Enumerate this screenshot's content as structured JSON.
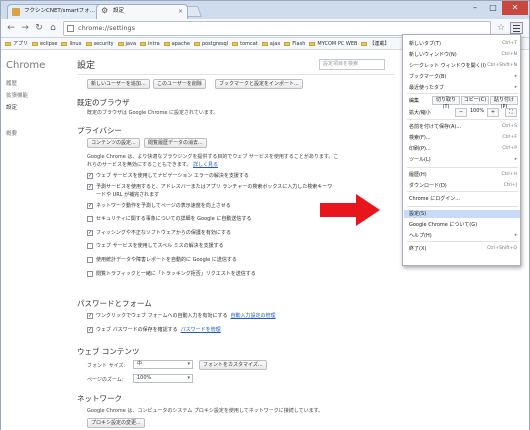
{
  "window": {
    "tabs": [
      {
        "title": "フクシンCNET/smartフォ…"
      },
      {
        "title": "設定"
      }
    ],
    "controls": {
      "minimize": "–",
      "maximize": "□",
      "close": "✕"
    }
  },
  "toolbar": {
    "url": "chrome://settings"
  },
  "bookmarks": [
    "アプリ",
    "eclipse",
    "linux",
    "security",
    "java",
    "intra",
    "apache",
    "postgresql",
    "tomcat",
    "ajax",
    "Flash",
    "MYCOM PC WEB",
    "【連載】"
  ],
  "sidebar": {
    "brand": "Chrome",
    "items": [
      "履歴",
      "拡張機能",
      "設定",
      "概要"
    ]
  },
  "settings": {
    "title": "設定",
    "search_placeholder": "設定項目を検索",
    "user_buttons": [
      "新しいユーザーを追加...",
      "このユーザーを削除",
      "ブックマークと設定をインポート..."
    ],
    "default_browser": {
      "heading": "既定のブラウザ",
      "text": "既定のブラウザは Google Chrome に設定されています。"
    },
    "privacy": {
      "heading": "プライバシー",
      "buttons": [
        "コンテンツの設定...",
        "閲覧履歴データの消去..."
      ],
      "desc1": "Google Chrome は、より快適なブラウジングを提供する目的でウェブ サービスを使用することがあります。こ",
      "desc2": "れらのサービスを無効にすることもできます。",
      "learn_more": "詳しく見る",
      "options": [
        {
          "label": "ウェブ サービスを使用してナビゲーション エラーの解決を支援する",
          "checked": true
        },
        {
          "label": "予測サービスを使用すると、アドレスバーまたはアプリ ランチャーの検索ボックスに入力した検索キーワ",
          "label2": "ードや URL が補完されます",
          "checked": true
        },
        {
          "label": "ネットワーク動作を予測してページの表示速度を向上させる",
          "checked": true
        },
        {
          "label": "セキュリティに関する事象についての詳細を Google に自動送信する",
          "checked": false
        },
        {
          "label": "フィッシングや不正なソフトウェアからの保護を有効にする",
          "checked": true
        },
        {
          "label": "ウェブ サービスを使用してスペル ミスの解決を支援する",
          "checked": false
        },
        {
          "label": "使用統計データや障害レポートを自動的に Google に送信する",
          "checked": false
        },
        {
          "label": "閲覧トラフィックと一緒に「トラッキング拒否」リクエストを送信する",
          "checked": false
        }
      ]
    },
    "passwords": {
      "heading": "パスワードとフォーム",
      "options": [
        {
          "label": "ワンクリックでウェブ フォームへの自動入力を有効にする",
          "link": "自動入力設定の管理",
          "checked": true
        },
        {
          "label": "ウェブ パスワードの保存を確認する",
          "link": "パスワードを管理",
          "checked": true
        }
      ]
    },
    "web_content": {
      "heading": "ウェブ コンテンツ",
      "font_size_label": "フォント サイズ:",
      "font_size_value": "中",
      "customize_fonts": "フォントをカスタマイズ...",
      "zoom_label": "ページのズーム:",
      "zoom_value": "100%"
    },
    "network": {
      "heading": "ネットワーク",
      "text": "Google Chrome は、コンピュータのシステム プロキシ設定を使用してネットワークに接続しています。",
      "button": "プロキシ設定の変更..."
    }
  },
  "menu": {
    "items": [
      {
        "label": "新しいタブ(T)",
        "shortcut": "Ctrl+T"
      },
      {
        "label": "新しいウィンドウ(N)",
        "shortcut": "Ctrl+N"
      },
      {
        "label": "シークレット ウィンドウを開く(I)",
        "shortcut": "Ctrl+Shift+N"
      },
      {
        "label": "ブックマーク(B)",
        "shortcut": "▸"
      },
      {
        "label": "最近使ったタブ",
        "shortcut": "▸"
      },
      {
        "label": "編集",
        "shortcut": ""
      },
      {
        "label": "拡大/縮小",
        "shortcut": ""
      },
      {
        "label": "名前を付けて保存(A)...",
        "shortcut": "Ctrl+S"
      },
      {
        "label": "検索(F)...",
        "shortcut": "Ctrl+F"
      },
      {
        "label": "印刷(P)...",
        "shortcut": "Ctrl+P"
      },
      {
        "label": "ツール(L)",
        "shortcut": "▸"
      },
      {
        "label": "履歴(H)",
        "shortcut": "Ctrl+H"
      },
      {
        "label": "ダウンロード(D)",
        "shortcut": "Ctrl+J"
      },
      {
        "label": "Chrome にログイン...",
        "shortcut": ""
      },
      {
        "label": "設定(S)",
        "shortcut": ""
      },
      {
        "label": "Google Chrome について(G)",
        "shortcut": ""
      },
      {
        "label": "ヘルプ(H)",
        "shortcut": "▸"
      },
      {
        "label": "終了(X)",
        "shortcut": "Ctrl+Shift+Q"
      }
    ],
    "edit_buttons": [
      "切り取り(T)",
      "コピー(C)",
      "貼り付け(P)"
    ],
    "zoom": {
      "minus": "−",
      "value": "100%",
      "plus": "+",
      "fullscreen": "⛶"
    },
    "highlighted": "設定(S)"
  },
  "colors": {
    "arrow": "#e8161c",
    "menu_highlight": "#c7dbf6",
    "link": "#1e5cc9"
  }
}
